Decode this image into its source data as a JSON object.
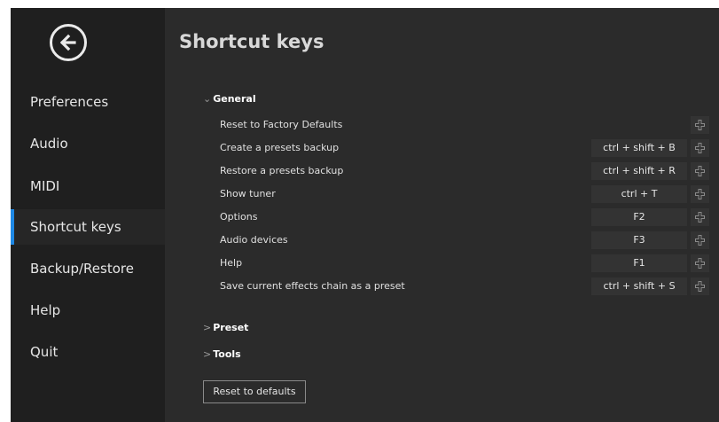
{
  "sidebar": {
    "back_icon": "arrow-left-circle-icon",
    "items": [
      {
        "label": "Preferences"
      },
      {
        "label": "Audio"
      },
      {
        "label": "MIDI"
      },
      {
        "label": "Shortcut keys",
        "active": true
      },
      {
        "label": "Backup/Restore"
      },
      {
        "label": "Help"
      },
      {
        "label": "Quit"
      }
    ]
  },
  "main": {
    "title": "Shortcut keys",
    "groups": {
      "general": {
        "label": "General",
        "expanded": true,
        "chevron": "⌄",
        "rows": [
          {
            "label": "Reset to Factory Defaults",
            "shortcut": ""
          },
          {
            "label": "Create a presets backup",
            "shortcut": "ctrl + shift + B"
          },
          {
            "label": "Restore a presets backup",
            "shortcut": "ctrl + shift + R"
          },
          {
            "label": "Show tuner",
            "shortcut": "ctrl + T"
          },
          {
            "label": "Options",
            "shortcut": "F2"
          },
          {
            "label": "Audio devices",
            "shortcut": "F3"
          },
          {
            "label": "Help",
            "shortcut": "F1"
          },
          {
            "label": "Save current effects chain as a preset",
            "shortcut": "ctrl + shift + S"
          }
        ]
      },
      "preset": {
        "label": "Preset",
        "expanded": false,
        "chevron": ">"
      },
      "tools": {
        "label": "Tools",
        "expanded": false,
        "chevron": ">"
      }
    },
    "reset_button": "Reset to defaults",
    "add_icon": "add-shortcut-icon"
  },
  "colors": {
    "accent": "#1e88e5",
    "sidebar_bg": "#1f1f1f",
    "main_bg": "#2b2b2b",
    "shortcut_bg": "#333333"
  }
}
